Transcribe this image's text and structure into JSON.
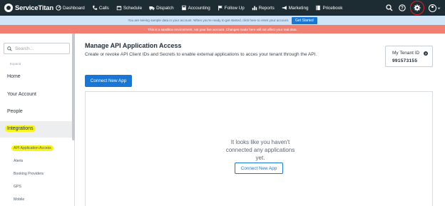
{
  "brand": {
    "name": "ServiceTitan"
  },
  "nav": {
    "items": [
      {
        "label": "Dashboard",
        "icon": "dashboard-icon"
      },
      {
        "label": "Calls",
        "icon": "phone-icon"
      },
      {
        "label": "Schedule",
        "icon": "calendar-icon"
      },
      {
        "label": "Dispatch",
        "icon": "truck-icon"
      },
      {
        "label": "Accounting",
        "icon": "accounting-icon"
      },
      {
        "label": "Follow Up",
        "icon": "flag-icon"
      },
      {
        "label": "Reports",
        "icon": "chart-icon"
      },
      {
        "label": "Marketing",
        "icon": "megaphone-icon"
      },
      {
        "label": "Pricebook",
        "icon": "book-icon"
      }
    ],
    "right_icons": [
      "search-icon",
      "help-icon",
      "gear-icon",
      "avatar-icon"
    ]
  },
  "banners": {
    "sample": "You are seeing sample data in your account. When you're ready to get started, click here to reset your account.",
    "get_started": "Get Started",
    "sandbox": "This is a sandbox environment, not your live account. Changes made here will not affect your real data."
  },
  "sidebar": {
    "search_placeholder": "Search...",
    "expand_label": "Expand",
    "items": [
      {
        "label": "Home"
      },
      {
        "label": "Your Account"
      },
      {
        "label": "People"
      },
      {
        "label": "Integrations"
      }
    ],
    "sub_items": [
      {
        "label": "API Application Access"
      },
      {
        "label": "Alerts"
      },
      {
        "label": "Booking Providers"
      },
      {
        "label": "GPS"
      },
      {
        "label": "Mobile"
      }
    ]
  },
  "main": {
    "title": "Manage API Application Access",
    "description": "Create or revoke API Client IDs and Secrets to enable external applications to acces your tenant through the API.",
    "connect_button": "Connect New App",
    "empty_line1": "It looks like you haven't",
    "empty_line2": "connected any applications",
    "empty_line3": "yet.",
    "empty_button": "Connect New App"
  },
  "tenant": {
    "label": "My Tenant ID",
    "help": "?",
    "id": "991573155"
  },
  "colors": {
    "nav_bg": "#1d2b33",
    "primary": "#1976d2",
    "banner_blue": "#cfe4f7",
    "banner_red": "#f07f72",
    "highlight": "#f7f51c",
    "annotation_circle": "#e02020"
  }
}
